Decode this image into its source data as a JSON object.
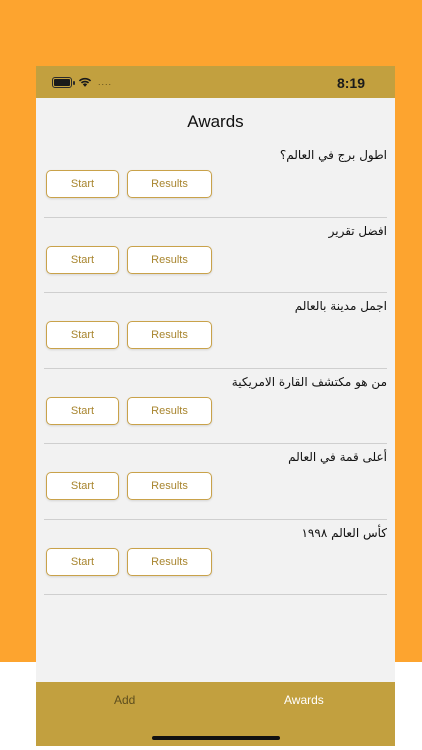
{
  "status_bar": {
    "time": "8:19",
    "signal_dots": "....",
    "battery_icon": "battery-icon",
    "wifi_icon": "wifi-icon"
  },
  "page": {
    "title": "Awards"
  },
  "quizzes": [
    {
      "question": "اطول برج في العالم؟",
      "start_label": "Start",
      "results_label": "Results"
    },
    {
      "question": "افضل تقرير",
      "start_label": "Start",
      "results_label": "Results"
    },
    {
      "question": "اجمل مدينة بالعالم",
      "start_label": "Start",
      "results_label": "Results"
    },
    {
      "question": "من هو مكتشف القارة الامريكية",
      "start_label": "Start",
      "results_label": "Results"
    },
    {
      "question": "أعلى قمة في العالم",
      "start_label": "Start",
      "results_label": "Results"
    },
    {
      "question": "كأس العالم ١٩٩٨",
      "start_label": "Start",
      "results_label": "Results"
    }
  ],
  "tab_bar": {
    "tabs": [
      {
        "label": "Add",
        "selected": false
      },
      {
        "label": "Awards",
        "selected": true
      }
    ]
  },
  "colors": {
    "background": "#FDA42F",
    "bar": "#C2A03F",
    "button_text": "#A8852E",
    "content_bg": "#F2F2F2"
  }
}
